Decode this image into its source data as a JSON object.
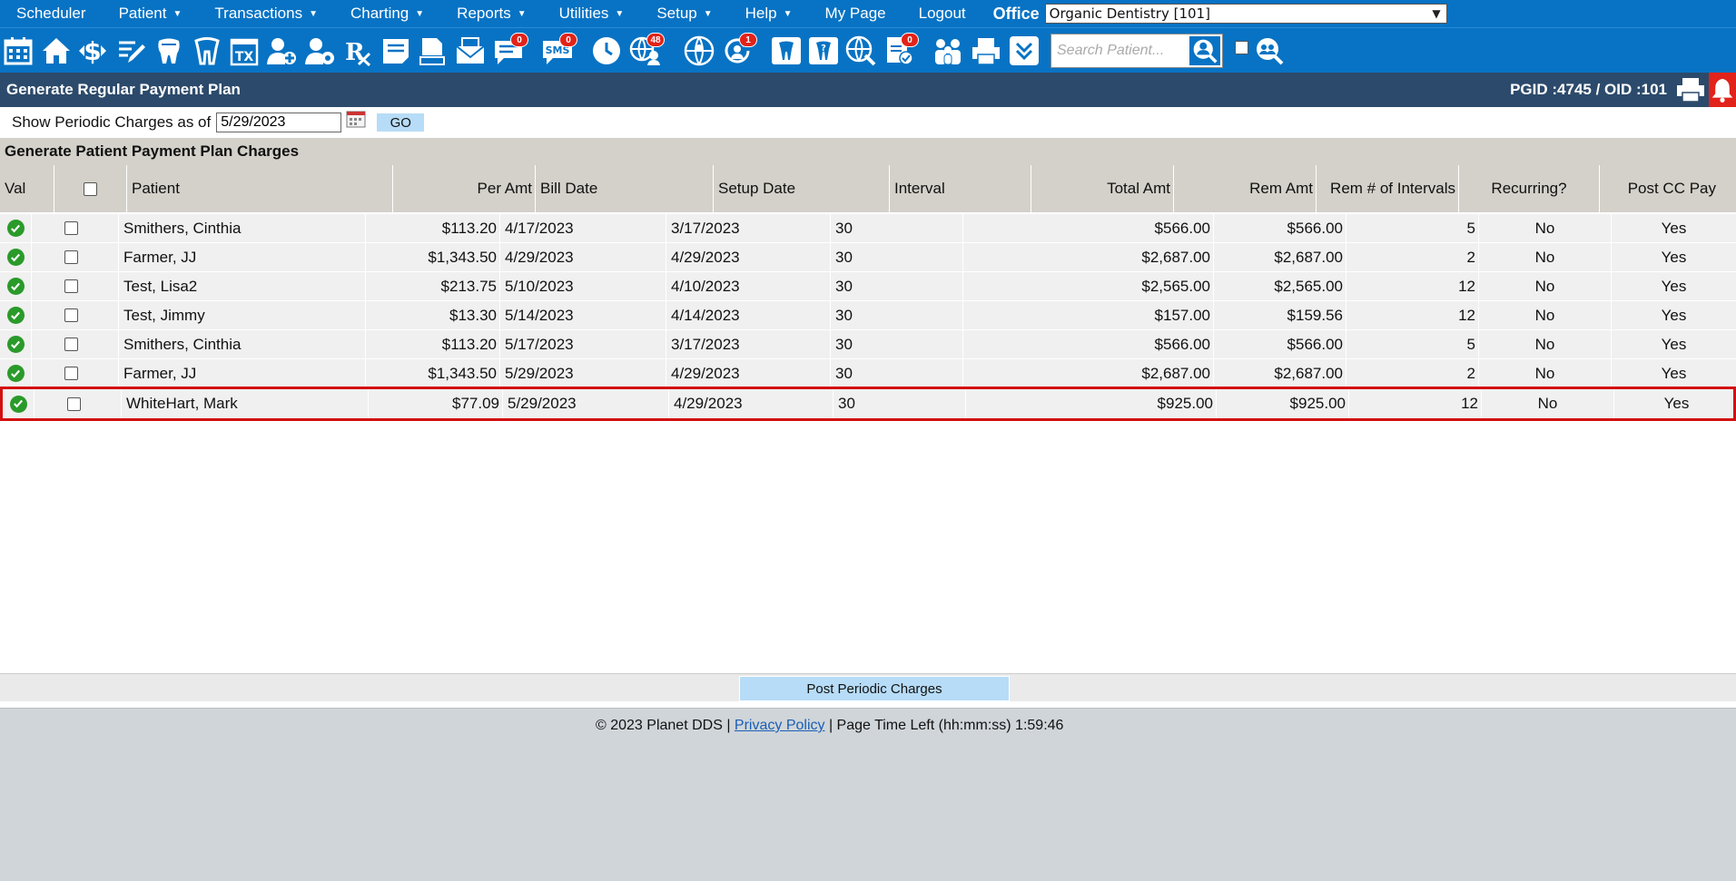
{
  "menu": {
    "items": [
      {
        "label": "Scheduler",
        "caret": false
      },
      {
        "label": "Patient",
        "caret": true
      },
      {
        "label": "Transactions",
        "caret": true
      },
      {
        "label": "Charting",
        "caret": true
      },
      {
        "label": "Reports",
        "caret": true
      },
      {
        "label": "Utilities",
        "caret": true
      },
      {
        "label": "Setup",
        "caret": true
      },
      {
        "label": "Help",
        "caret": true
      },
      {
        "label": "My Page",
        "caret": false
      },
      {
        "label": "Logout",
        "caret": false
      }
    ],
    "office_label": "Office",
    "office_value": "Organic Dentistry [101]"
  },
  "toolbar": {
    "badges": {
      "messages": "0",
      "sms": "0",
      "online": "48",
      "recall": "1",
      "forms": "0"
    },
    "sms_text": "SMS",
    "tx_text": "TX",
    "search_placeholder": "Search Patient..."
  },
  "titlebar": {
    "title": "Generate Regular Payment Plan",
    "ids": "PGID :4745  /  OID :101"
  },
  "filter": {
    "label": "Show Periodic Charges as of",
    "date": "5/29/2023",
    "go_label": "GO"
  },
  "section_title": "Generate Patient Payment Plan Charges",
  "table": {
    "headers": {
      "val": "Val",
      "patient": "Patient",
      "per_amt": "Per Amt",
      "bill_date": "Bill Date",
      "setup_date": "Setup Date",
      "interval": "Interval",
      "total_amt": "Total Amt",
      "rem_amt": "Rem Amt",
      "rem_intervals": "Rem # of Intervals",
      "recurring": "Recurring?",
      "post_cc": "Post CC Pay"
    },
    "rows": [
      {
        "patient": "Smithers, Cinthia",
        "per_amt": "$113.20",
        "bill_date": "4/17/2023",
        "setup_date": "3/17/2023",
        "interval": "30",
        "total_amt": "$566.00",
        "rem_amt": "$566.00",
        "rem_intervals": "5",
        "recurring": "No",
        "post_cc": "Yes"
      },
      {
        "patient": "Farmer, JJ",
        "per_amt": "$1,343.50",
        "bill_date": "4/29/2023",
        "setup_date": "4/29/2023",
        "interval": "30",
        "total_amt": "$2,687.00",
        "rem_amt": "$2,687.00",
        "rem_intervals": "2",
        "recurring": "No",
        "post_cc": "Yes"
      },
      {
        "patient": "Test, Lisa2",
        "per_amt": "$213.75",
        "bill_date": "5/10/2023",
        "setup_date": "4/10/2023",
        "interval": "30",
        "total_amt": "$2,565.00",
        "rem_amt": "$2,565.00",
        "rem_intervals": "12",
        "recurring": "No",
        "post_cc": "Yes"
      },
      {
        "patient": "Test, Jimmy",
        "per_amt": "$13.30",
        "bill_date": "5/14/2023",
        "setup_date": "4/14/2023",
        "interval": "30",
        "total_amt": "$157.00",
        "rem_amt": "$159.56",
        "rem_intervals": "12",
        "recurring": "No",
        "post_cc": "Yes"
      },
      {
        "patient": "Smithers, Cinthia",
        "per_amt": "$113.20",
        "bill_date": "5/17/2023",
        "setup_date": "3/17/2023",
        "interval": "30",
        "total_amt": "$566.00",
        "rem_amt": "$566.00",
        "rem_intervals": "5",
        "recurring": "No",
        "post_cc": "Yes"
      },
      {
        "patient": "Farmer, JJ",
        "per_amt": "$1,343.50",
        "bill_date": "5/29/2023",
        "setup_date": "4/29/2023",
        "interval": "30",
        "total_amt": "$2,687.00",
        "rem_amt": "$2,687.00",
        "rem_intervals": "2",
        "recurring": "No",
        "post_cc": "Yes"
      },
      {
        "patient": "WhiteHart, Mark",
        "per_amt": "$77.09",
        "bill_date": "5/29/2023",
        "setup_date": "4/29/2023",
        "interval": "30",
        "total_amt": "$925.00",
        "rem_amt": "$925.00",
        "rem_intervals": "12",
        "recurring": "No",
        "post_cc": "Yes",
        "highlighted": true
      }
    ]
  },
  "post_button": "Post Periodic Charges",
  "footer": {
    "copyright": "© 2023 Planet DDS | ",
    "privacy": "Privacy Policy",
    "time_left": " |  Page Time Left (hh:mm:ss) 1:59:46"
  },
  "colors": {
    "menu_bg": "#0873c4",
    "title_bg": "#2c4a6b",
    "header_bg": "#d4d1ca",
    "highlight_border": "#d40f0f",
    "ok_green": "#2a9a2a",
    "go_button": "#b7dcf7"
  }
}
